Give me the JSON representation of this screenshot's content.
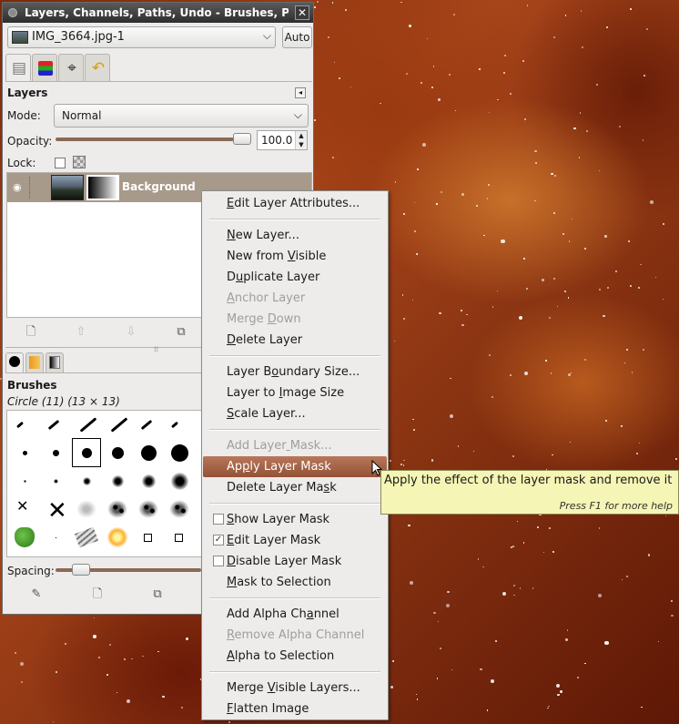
{
  "window": {
    "title": "Layers, Channels, Paths, Undo - Brushes, Patt",
    "close_symbol": "✕"
  },
  "image_selector": {
    "value": "IMG_3664.jpg-1",
    "auto_label": "Auto"
  },
  "layers_panel": {
    "title": "Layers",
    "mode_label": "Mode:",
    "mode_value": "Normal",
    "opacity_label": "Opacity:",
    "opacity_value": "100.0",
    "opacity_fraction": 1.0,
    "lock_label": "Lock:",
    "layer_name": "Background"
  },
  "brushes_panel": {
    "title": "Brushes",
    "selected": "Circle (11) (13 × 13)",
    "spacing_label": "Spacing:"
  },
  "context_menu": {
    "items": [
      {
        "label": "Edit Layer Attributes...",
        "enabled": true
      },
      {
        "sep": true
      },
      {
        "label": "New Layer...",
        "enabled": true
      },
      {
        "label": "New from Visible",
        "enabled": true
      },
      {
        "label": "Duplicate Layer",
        "enabled": true
      },
      {
        "label": "Anchor Layer",
        "enabled": false
      },
      {
        "label": "Merge Down",
        "enabled": false
      },
      {
        "label": "Delete Layer",
        "enabled": true
      },
      {
        "sep": true
      },
      {
        "label": "Layer Boundary Size...",
        "enabled": true
      },
      {
        "label": "Layer to Image Size",
        "enabled": true
      },
      {
        "label": "Scale Layer...",
        "enabled": true
      },
      {
        "sep": true
      },
      {
        "label": "Add Layer Mask...",
        "enabled": false
      },
      {
        "label": "Apply Layer Mask",
        "enabled": true,
        "highlighted": true
      },
      {
        "label": "Delete Layer Mask",
        "enabled": true
      },
      {
        "sep": true
      },
      {
        "label": "Show Layer Mask",
        "enabled": true,
        "checkbox": true,
        "checked": false
      },
      {
        "label": "Edit Layer Mask",
        "enabled": true,
        "checkbox": true,
        "checked": true
      },
      {
        "label": "Disable Layer Mask",
        "enabled": true,
        "checkbox": true,
        "checked": false
      },
      {
        "label": "Mask to Selection",
        "enabled": true
      },
      {
        "sep": true
      },
      {
        "label": "Add Alpha Channel",
        "enabled": true
      },
      {
        "label": "Remove Alpha Channel",
        "enabled": false
      },
      {
        "label": "Alpha to Selection",
        "enabled": true
      },
      {
        "sep": true
      },
      {
        "label": "Merge Visible Layers...",
        "enabled": true
      },
      {
        "label": "Flatten Image",
        "enabled": true
      }
    ]
  },
  "tooltip": {
    "text": "Apply the effect of the layer mask and remove it",
    "hint": "Press F1 for more help"
  },
  "colors": {
    "highlight": "#a0603f",
    "tooltip_bg": "#f5f5b5",
    "dock_bg": "#edeceb"
  }
}
